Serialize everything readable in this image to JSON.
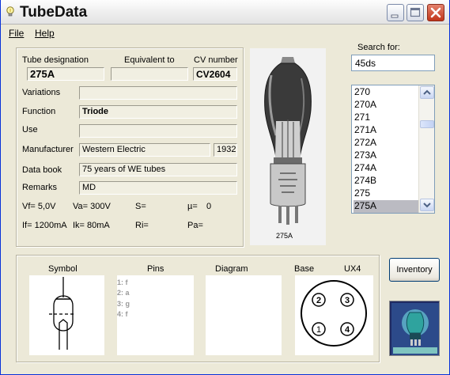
{
  "window": {
    "title": "TubeData"
  },
  "menu": {
    "file": "File",
    "help": "Help"
  },
  "info": {
    "tube_designation_label": "Tube designation",
    "tube_designation": "275A",
    "equivalent_label": "Equivalent to",
    "equivalent": "",
    "cv_label": "CV number",
    "cv": "CV2604",
    "variations_label": "Variations",
    "variations": "",
    "function_label": "Function",
    "function": "Triode",
    "use_label": "Use",
    "use": "",
    "manufacturer_label": "Manufacturer",
    "manufacturer": "Western Electric",
    "year": "1932",
    "databook_label": "Data book",
    "databook": "75 years of WE tubes",
    "remarks_label": "Remarks",
    "remarks": "MD",
    "params_row1": [
      "Vf= 5,0V",
      "Va= 300V",
      "S=",
      "µ=",
      "0"
    ],
    "params_row2": [
      "If= 1200mA",
      "Ik= 80mA",
      "Ri=",
      "Pa="
    ]
  },
  "photo": {
    "caption": "275A"
  },
  "search": {
    "label": "Search for:",
    "value": "45ds"
  },
  "list": {
    "items": [
      "270",
      "270A",
      "271",
      "271A",
      "272A",
      "273A",
      "274A",
      "274B",
      "275",
      "275A"
    ],
    "selected_index": 9
  },
  "bottom": {
    "symbol_label": "Symbol",
    "pins_label": "Pins",
    "diagram_label": "Diagram",
    "base_label": "Base",
    "base_type": "UX4",
    "pins": [
      "1: f",
      "2: a",
      "3: g",
      "4: f"
    ],
    "base_pin_numbers": [
      "2",
      "3",
      "1",
      "4"
    ]
  },
  "inventory_button": "Inventory",
  "colors": {
    "title_close": "#c2351a",
    "selection": "#bbbbc2",
    "field_bg": "#f1efe2",
    "logo_bg": "#24306a"
  }
}
